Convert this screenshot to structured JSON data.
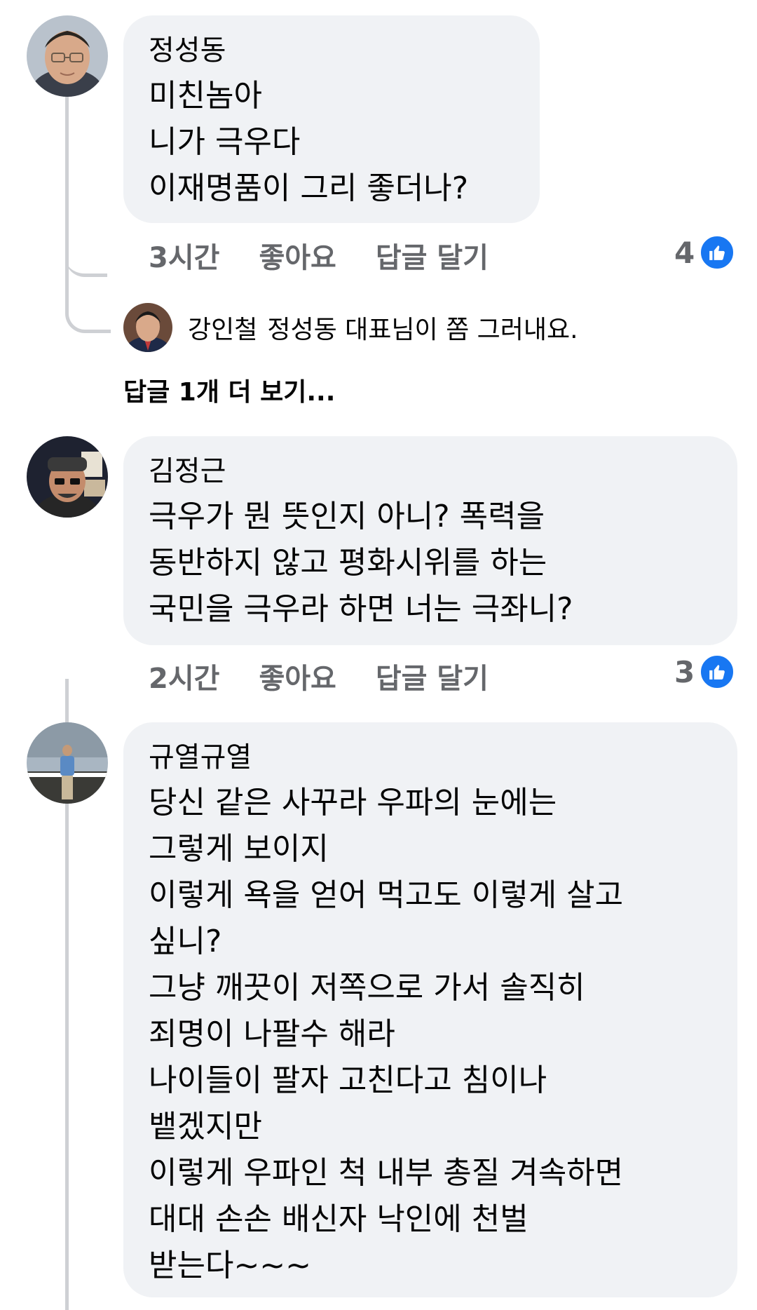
{
  "comments": [
    {
      "author": "정성동",
      "text": "미친놈아\n니가 극우다\n이재명품이 그리 좋더나?",
      "time": "3시간",
      "like_label": "좋아요",
      "reply_label": "답글 달기",
      "reaction_count": "4",
      "reaction_icon": "like-thumb-icon"
    },
    {
      "author": "김정근",
      "text": "극우가 뭔 뜻인지 아니? 폭력을\n동반하지 않고 평화시위를 하는\n국민을 극우라 하면 너는 극좌니?",
      "time": "2시간",
      "like_label": "좋아요",
      "reply_label": "답글 달기",
      "reaction_count": "3",
      "reaction_icon": "like-thumb-icon"
    },
    {
      "author": "규열규열",
      "text": "당신 같은 사꾸라 우파의 눈에는\n그렇게 보이지\n이렇게 욕을 얻어 먹고도 이렇게 살고\n싶니?\n그냥 깨끗이 저쪽으로 가서 솔직히\n죄명이 나팔수 해라\n나이들이 팔자 고친다고 침이나\n뱉겠지만\n이렇게 우파인 척 내부 총질 겨속하면\n대대 손손 배신자 낙인에 천벌\n받는다~~~"
    }
  ],
  "reply": {
    "author": "강인철",
    "text": "정성동 대표님이 쫌 그러내요."
  },
  "more_replies": "답글 1개 더 보기...",
  "colors": {
    "bubble": "#f0f2f5",
    "meta": "#65676b",
    "like_blue": "#1877f2",
    "thread_line": "#ced0d4"
  }
}
